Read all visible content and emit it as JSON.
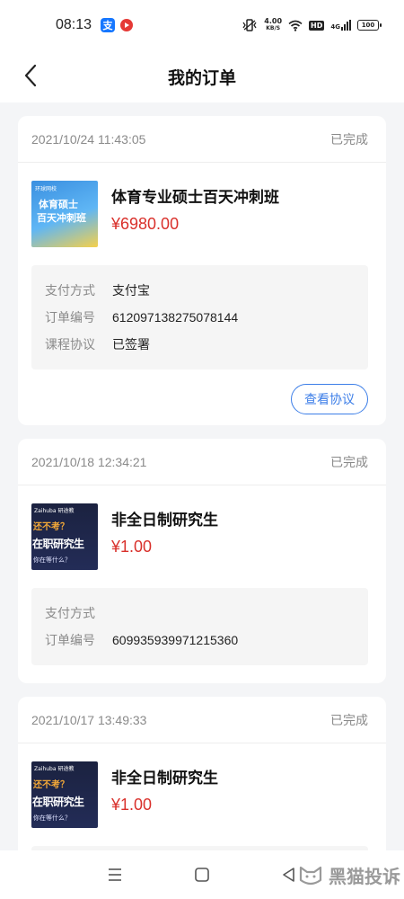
{
  "status_bar": {
    "time": "08:13",
    "alipay_glyph": "支",
    "net_speed_value": "4.00",
    "net_speed_unit": "KB/S",
    "hd_label": "HD",
    "network_label": "4G",
    "battery": "100"
  },
  "header": {
    "title": "我的订单",
    "back_icon": "chevron-left-icon"
  },
  "orders": [
    {
      "date": "2021/10/24 11:43:05",
      "status": "已完成",
      "thumbnail": {
        "logo": "环球网校",
        "line1": "体育硕士",
        "line2": "百天冲刺班"
      },
      "product_name": "体育专业硕士百天冲刺班",
      "price": "¥6980.00",
      "details": [
        {
          "label": "支付方式",
          "value": "支付宝"
        },
        {
          "label": "订单编号",
          "value": "612097138275078144"
        },
        {
          "label": "课程协议",
          "value": "已签署"
        }
      ],
      "action_label": "查看协议"
    },
    {
      "date": "2021/10/18 12:34:21",
      "status": "已完成",
      "thumbnail": {
        "logo": "Zaihuba 研途教",
        "question": "还不考？",
        "main": "在职研究生",
        "sub": "你在等什么？"
      },
      "product_name": "非全日制研究生",
      "price": "¥1.00",
      "details": [
        {
          "label": "支付方式",
          "value": ""
        },
        {
          "label": "订单编号",
          "value": "609935939971215360"
        }
      ]
    },
    {
      "date": "2021/10/17 13:49:33",
      "status": "已完成",
      "thumbnail": {
        "logo": "Zaihuba 研途教",
        "question": "还不考？",
        "main": "在职研究生",
        "sub": "你在等什么？"
      },
      "product_name": "非全日制研究生",
      "price": "¥1.00"
    }
  ],
  "watermark": "黑猫投诉",
  "colors": {
    "price": "#d9302b",
    "accent": "#3c7ee8",
    "muted_text": "#8a8a8a",
    "page_bg": "#f4f5f7"
  }
}
